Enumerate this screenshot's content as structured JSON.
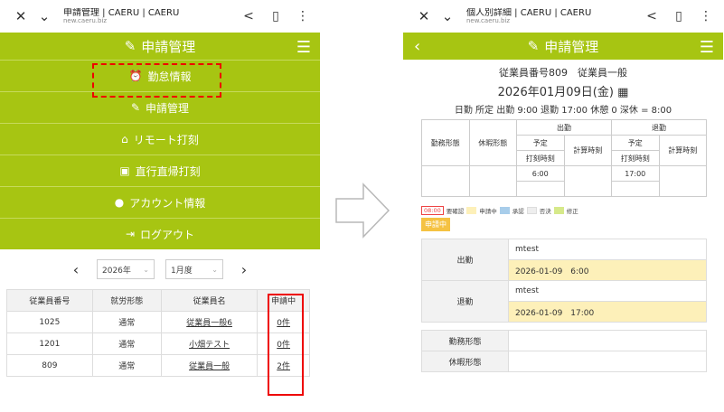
{
  "left": {
    "browser": {
      "title": "申請管理 | CAERU | CAERU",
      "url": "new.caeru.biz"
    },
    "header": {
      "title": "申請管理"
    },
    "menu": [
      {
        "label": "勤怠情報",
        "icon": "alarm-clock-icon"
      },
      {
        "label": "申請管理",
        "icon": "edit-icon"
      },
      {
        "label": "リモート打刻",
        "icon": "home-icon"
      },
      {
        "label": "直行直帰打刻",
        "icon": "briefcase-icon"
      },
      {
        "label": "アカウント情報",
        "icon": "user-icon"
      },
      {
        "label": "ログアウト",
        "icon": "logout-icon"
      }
    ],
    "filter": {
      "year": "2026年",
      "month": "1月度"
    },
    "table": {
      "headers": [
        "従業員番号",
        "就労形態",
        "従業員名",
        "申請中"
      ],
      "rows": [
        [
          "1025",
          "通常",
          "従業員一般6",
          "0件"
        ],
        [
          "1201",
          "通常",
          "小畑テスト",
          "0件"
        ],
        [
          "809",
          "通常",
          "従業員一般",
          "2件"
        ]
      ]
    }
  },
  "right": {
    "browser": {
      "title": "個人別詳細 | CAERU | CAERU",
      "url": "new.caeru.biz"
    },
    "header": {
      "title": "申請管理"
    },
    "employee_line": "従業員番号809　従業員一般",
    "date_line": "2026年01月09日(金)",
    "schedule_line": "日勤 所定  出勤 9:00  退勤 17:00  休憩 0  深休 =  8:00",
    "att_table": {
      "work_type": "勤務形態",
      "leave_type": "休暇形態",
      "in": "出勤",
      "out": "退勤",
      "planned": "予定",
      "stamp": "打刻時刻",
      "calc": "計算時刻",
      "in_time": "6:00",
      "out_time": "17:00"
    },
    "legend": {
      "time": "08:00",
      "items": [
        {
          "label": "要確認",
          "color": "#fdf0b9"
        },
        {
          "label": "申請中",
          "color": "#a8cdea"
        },
        {
          "label": "承認",
          "color": "#eeeeee"
        },
        {
          "label": "否決",
          "color": "#d6e98a"
        },
        {
          "label": "修正",
          "color": "#ffffff"
        }
      ]
    },
    "badge": "申請中",
    "details": {
      "in_label": "出勤",
      "in_user": "mtest",
      "in_value": "2026-01-09　6:00",
      "out_label": "退勤",
      "out_user": "mtest",
      "out_value": "2026-01-09　17:00",
      "work_type_label": "勤務形態",
      "leave_type_label": "休暇形態"
    }
  }
}
